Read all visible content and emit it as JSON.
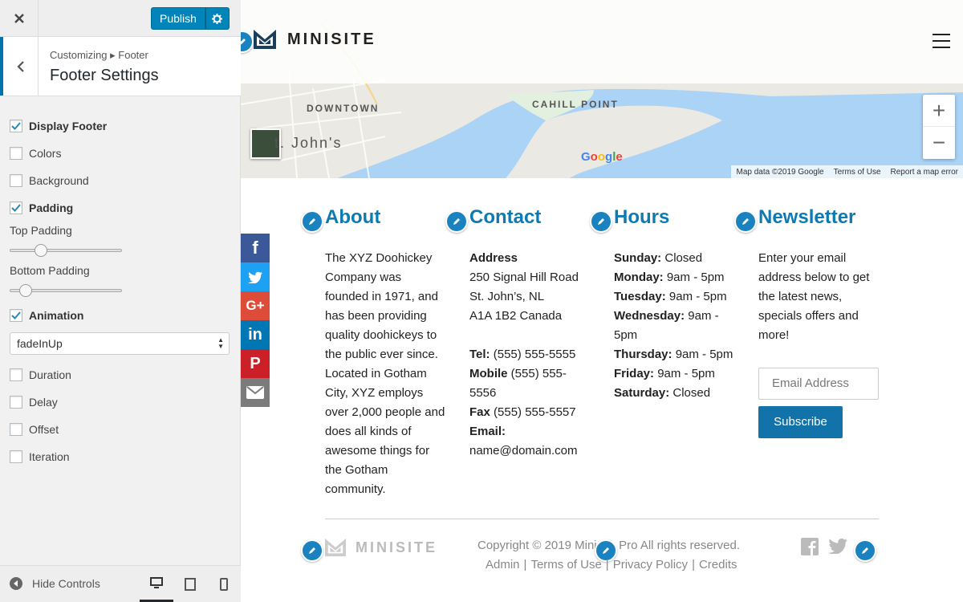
{
  "customizer": {
    "publish_label": "Publish",
    "breadcrumb": "Customizing ▸ Footer",
    "section_title": "Footer Settings",
    "controls": {
      "display_footer": "Display Footer",
      "colors": "Colors",
      "background": "Background",
      "padding": "Padding",
      "top_padding": "Top Padding",
      "bottom_padding": "Bottom Padding",
      "animation": "Animation",
      "animation_value": "fadeInUp",
      "duration": "Duration",
      "delay": "Delay",
      "offset": "Offset",
      "iteration": "Iteration"
    },
    "top_padding_level": 0.25,
    "bottom_padding_level": 0.1,
    "hide_controls": "Hide Controls",
    "accent": "#0085ba"
  },
  "site": {
    "logo_text": "MINISITE",
    "brand_color": "#1a3e5c",
    "link_color": "#0d7ab3"
  },
  "map": {
    "labels": {
      "downtown": "DOWNTOWN",
      "cahill": "CAHILL POINT",
      "city": "t. John's",
      "google": "Google"
    },
    "attribution": [
      "Map data ©2019 Google",
      "Terms of Use",
      "Report a map error"
    ],
    "zoom_in": "+",
    "zoom_out": "−"
  },
  "footer": {
    "about": {
      "title": "About",
      "text": "The XYZ Doohickey Company was founded in 1971, and has been providing quality doohickeys to the public ever since. Located in Gotham City, XYZ employs over 2,000 people and does all kinds of awesome things for the Gotham community."
    },
    "contact": {
      "title": "Contact",
      "address_label": "Address",
      "address_lines": [
        "250 Signal Hill Road",
        "St. John’s, NL",
        "A1A 1B2 Canada"
      ],
      "tel_label": "Tel:",
      "tel": "(555) 555-5555",
      "mobile_label": "Mobile",
      "mobile": "(555) 555-5556",
      "fax_label": "Fax",
      "fax": "(555) 555-5557",
      "email_label": "Email:",
      "email": "name@domain.com"
    },
    "hours": {
      "title": "Hours",
      "rows": [
        {
          "day": "Sunday:",
          "time": "Closed"
        },
        {
          "day": "Monday:",
          "time": "9am - 5pm"
        },
        {
          "day": "Tuesday:",
          "time": "9am - 5pm"
        },
        {
          "day": "Wednesday:",
          "time": "9am - 5pm"
        },
        {
          "day": "Thursday:",
          "time": "9am - 5pm"
        },
        {
          "day": "Friday:",
          "time": "9am - 5pm"
        },
        {
          "day": "Saturday:",
          "time": "Closed"
        }
      ]
    },
    "newsletter": {
      "title": "Newsletter",
      "text": "Enter your email address below to get the latest news, specials offers and more!",
      "placeholder": "Email Address",
      "button": "Subscribe"
    },
    "bottom": {
      "logo_text": "MINISITE",
      "copyright": "Copyright © 2019 Minisite Pro All rights reserved.",
      "links": [
        "Admin",
        "Terms of Use",
        "Privacy Policy",
        "Credits"
      ]
    }
  },
  "social": [
    {
      "icon": "facebook-icon",
      "color": "#3b5998",
      "glyph": "f"
    },
    {
      "icon": "twitter-icon",
      "color": "#1da1f2",
      "glyph": ""
    },
    {
      "icon": "google-plus-icon",
      "color": "#dd4b39",
      "glyph": "G+"
    },
    {
      "icon": "linkedin-icon",
      "color": "#0077b5",
      "glyph": "in"
    },
    {
      "icon": "pinterest-icon",
      "color": "#cb2027",
      "glyph": "P"
    },
    {
      "icon": "email-icon",
      "color": "#7b7b7b",
      "glyph": ""
    }
  ]
}
